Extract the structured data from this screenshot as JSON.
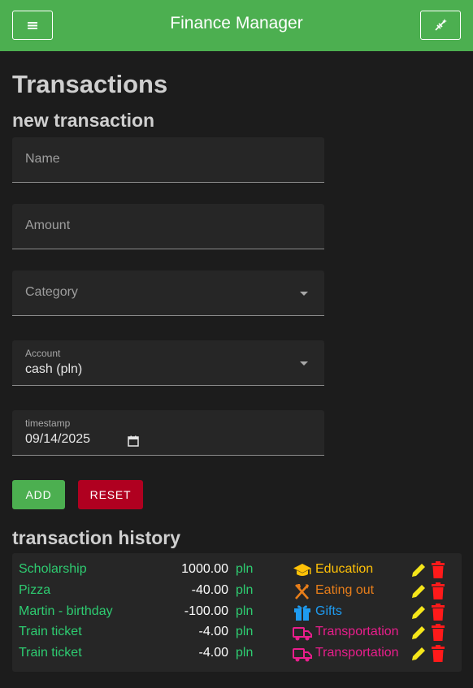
{
  "header": {
    "title": "Finance Manager",
    "menu_icon": "menu-icon",
    "theme_icon": "theme-toggle-icon"
  },
  "page": {
    "title": "Transactions"
  },
  "new_transaction": {
    "heading": "new transaction",
    "name_placeholder": "Name",
    "amount_placeholder": "Amount",
    "category_placeholder": "Category",
    "account_label": "Account",
    "account_value": "cash (pln)",
    "timestamp_label": "timestamp",
    "timestamp_value": "09/14/2025",
    "add_label": "ADD",
    "reset_label": "RESET"
  },
  "history": {
    "heading": "transaction history",
    "rows": [
      {
        "name": "Scholarship",
        "amount": "1000.00",
        "currency": "pln",
        "category": "Education",
        "icon": "education-icon",
        "color": "#ffc107"
      },
      {
        "name": "Pizza",
        "amount": "-40.00",
        "currency": "pln",
        "category": "Eating out",
        "icon": "fork-knife-icon",
        "color": "#e87e1a"
      },
      {
        "name": "Martin - birthday",
        "amount": "-100.00",
        "currency": "pln",
        "category": "Gifts",
        "icon": "gift-icon",
        "color": "#1e9bf0"
      },
      {
        "name": "Train ticket",
        "amount": "-4.00",
        "currency": "pln",
        "category": "Transportation",
        "icon": "truck-icon",
        "color": "#e91e8c"
      },
      {
        "name": "Train ticket",
        "amount": "-4.00",
        "currency": "pln",
        "category": "Transportation",
        "icon": "truck-icon",
        "color": "#e91e8c"
      }
    ]
  },
  "colors": {
    "accent": "#4caf50",
    "danger": "#b00020",
    "amount_text": "#2ecc71",
    "edit": "#f5e61a",
    "delete": "#ff1a1a"
  }
}
